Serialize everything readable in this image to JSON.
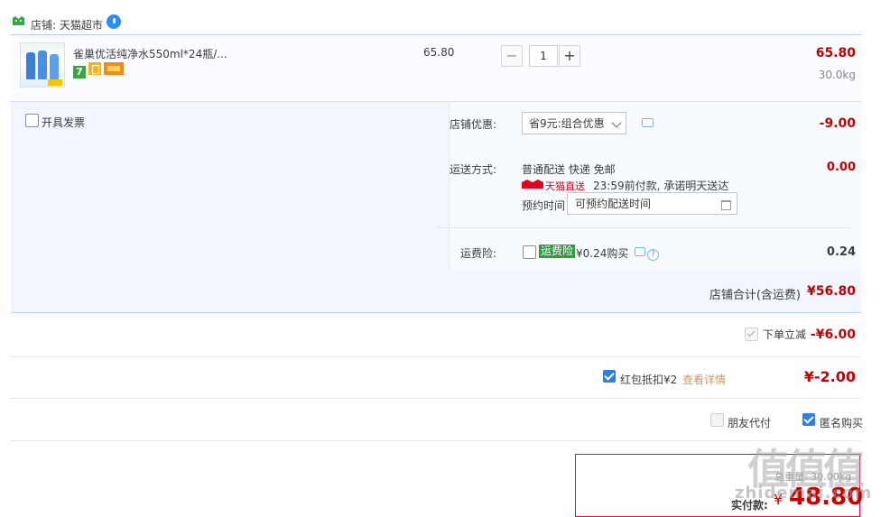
{
  "shop": {
    "label": "店铺: 天猫超市",
    "colors": {
      "shop_icon": "#33aa44",
      "wangwang": "#2d8df5"
    }
  },
  "item": {
    "title": "雀巢优活纯净水550ml*24瓶/...",
    "tag_7": "7",
    "unit_price": "65.80",
    "quantity": "1",
    "minus": "−",
    "plus": "+",
    "total": "65.80",
    "weight": "30.0kg"
  },
  "invoice": {
    "label": "开具发票"
  },
  "coupon": {
    "label": "店铺优惠:",
    "selected": "省9元:组合优惠",
    "amount": "-9.00"
  },
  "shipping": {
    "label": "运送方式:",
    "method": "普通配送 快递 免邮",
    "tmall_direct": "天猫直送",
    "promise": "23:59前付款, 承诺明天送达",
    "schedule_label": "预约时间",
    "schedule_value": "可预约配送时间",
    "amount": "0.00"
  },
  "insurance": {
    "label": "运费险:",
    "badge": "运费险",
    "text": "¥0.24购买",
    "amount": "0.24"
  },
  "subtotal": {
    "label": "店铺合计(含运费)",
    "amount": "¥56.80"
  },
  "discount": {
    "label": "下单立减",
    "amount": "-¥6.00"
  },
  "redpacket": {
    "label": "红包抵扣¥2",
    "link": "查看详情",
    "amount": "¥-2.00"
  },
  "options": {
    "friend_pay": "朋友代付",
    "anonymous": "匿名购买"
  },
  "pay": {
    "meta": "总重量: 30.00kg",
    "label": "实付款:",
    "yen": "¥",
    "amount": "48.80"
  },
  "watermark": {
    "logo": "值值值",
    "text": "zhidemai.com"
  },
  "colors": {
    "accent_red": "#c40000",
    "link_blue": "#2f7fe0",
    "border_blue": "#b2d1ff",
    "panel_bg": "#f2f7ff"
  }
}
